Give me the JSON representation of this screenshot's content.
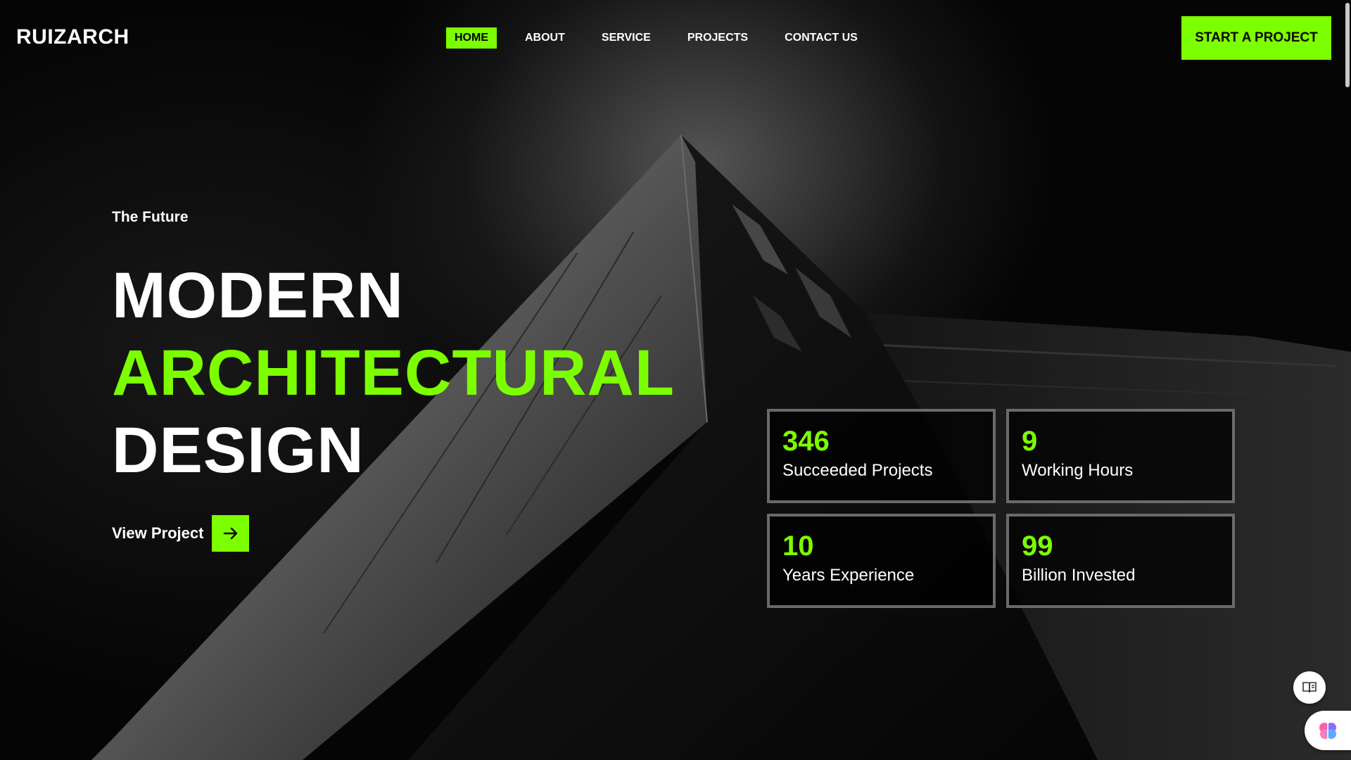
{
  "brand": {
    "name": "RUIZARCH"
  },
  "nav": {
    "items": [
      {
        "label": "HOME",
        "active": true
      },
      {
        "label": "ABOUT",
        "active": false
      },
      {
        "label": "SERVICE",
        "active": false
      },
      {
        "label": "PROJECTS",
        "active": false
      },
      {
        "label": "CONTACT US",
        "active": false
      }
    ],
    "cta_label": "START A PROJECT"
  },
  "hero": {
    "eyebrow": "The Future",
    "headline": [
      "MODERN",
      "ARCHITECTURAL",
      "DESIGN"
    ],
    "view_project_label": "View Project",
    "arrow_icon": "arrow-right-icon"
  },
  "stats": [
    {
      "value": "346",
      "label": "Succeeded Projects"
    },
    {
      "value": "9",
      "label": "Working Hours"
    },
    {
      "value": "10",
      "label": "Years Experience"
    },
    {
      "value": "99",
      "label": "Billion Invested"
    }
  ],
  "widgets": {
    "reader_icon": "book-icon",
    "assistant_icon": "brain-icon"
  },
  "colors": {
    "accent": "#7cff00",
    "background": "#000000",
    "stat_border": "#6a6a6a"
  }
}
